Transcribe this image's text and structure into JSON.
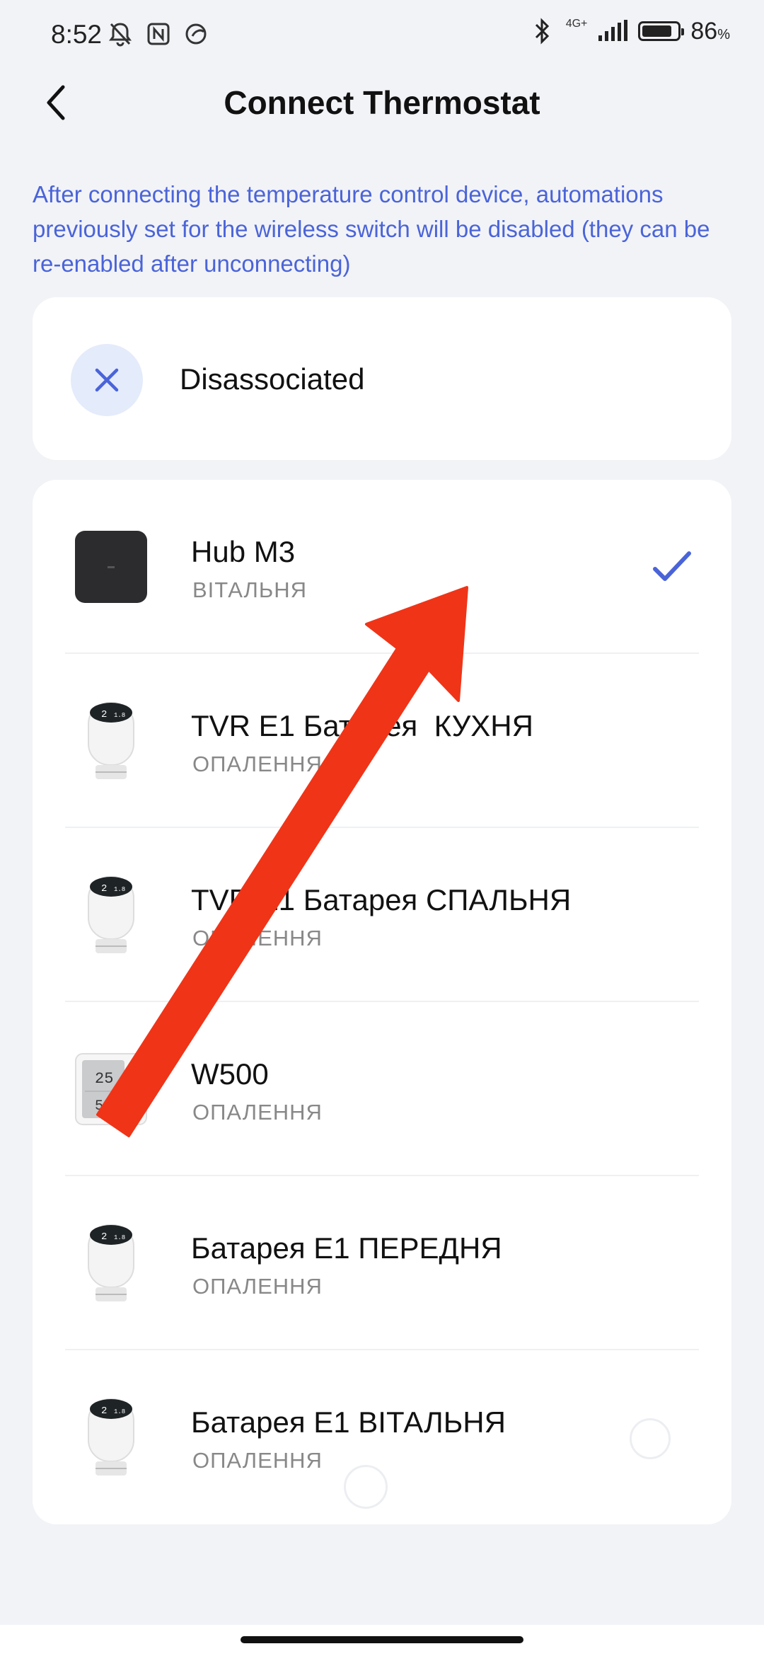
{
  "status_bar": {
    "time": "8:52",
    "network": "4G+",
    "battery_percent": "86",
    "battery_unit": "%",
    "battery_level": 0.86,
    "icons": [
      "silent-bell-icon",
      "nfc-icon",
      "app-notification-icon",
      "bluetooth-icon",
      "signal-icon",
      "battery-icon"
    ]
  },
  "header": {
    "title": "Connect Thermostat",
    "back_icon": "chevron-left-icon"
  },
  "notice": "After connecting the temperature control device, automations previously set for the wireless switch will be disabled (they can be re-enabled after unconnecting)",
  "disassociated": {
    "label": "Disassociated",
    "icon": "close-icon"
  },
  "devices": [
    {
      "name": "Hub M3",
      "room": "ВІТАЛЬНЯ",
      "image": "hub-icon",
      "selected": true
    },
    {
      "name": "TVR E1 Батарея  КУХНЯ",
      "room": "ОПАЛЕННЯ",
      "image": "thermostat-valve-icon",
      "selected": false
    },
    {
      "name": "TVR E1 Батарея СПАЛЬНЯ",
      "room": "ОПАЛЕННЯ",
      "image": "thermostat-valve-icon",
      "selected": false
    },
    {
      "name": "W500",
      "room": "ОПАЛЕННЯ",
      "image": "wall-thermostat-icon",
      "selected": false
    },
    {
      "name": "Батарея E1 ПЕРЕДНЯ",
      "room": "ОПАЛЕННЯ",
      "image": "thermostat-valve-icon",
      "selected": false
    },
    {
      "name": "Батарея E1 ВІТАЛЬНЯ",
      "room": "ОПАЛЕННЯ",
      "image": "thermostat-valve-icon",
      "selected": false
    }
  ],
  "colors": {
    "accent": "#4a64d8",
    "background": "#f2f3f7",
    "annotation_arrow": "#f03418"
  }
}
